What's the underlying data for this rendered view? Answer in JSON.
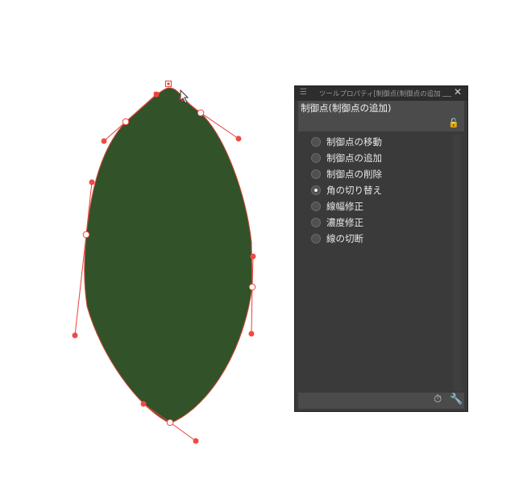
{
  "colors": {
    "leaf_fill": "#325229",
    "control_line": "#e8403a",
    "control_point": "#f04b43"
  },
  "panel": {
    "title": "ツールプロパティ[制御点(制御点の追加)]",
    "header_label": "制御点(制御点の追加)",
    "menu_icon": "hamburger-icon",
    "lock_icon": "unlock-icon",
    "options": [
      {
        "label": "制御点の移動",
        "checked": false
      },
      {
        "label": "制御点の追加",
        "checked": false
      },
      {
        "label": "制御点の削除",
        "checked": false
      },
      {
        "label": "角の切り替え",
        "checked": true
      },
      {
        "label": "線幅修正",
        "checked": false
      },
      {
        "label": "濃度修正",
        "checked": false
      },
      {
        "label": "線の切断",
        "checked": false
      }
    ],
    "footer_icons": [
      "reset-icon",
      "wrench-icon"
    ]
  }
}
